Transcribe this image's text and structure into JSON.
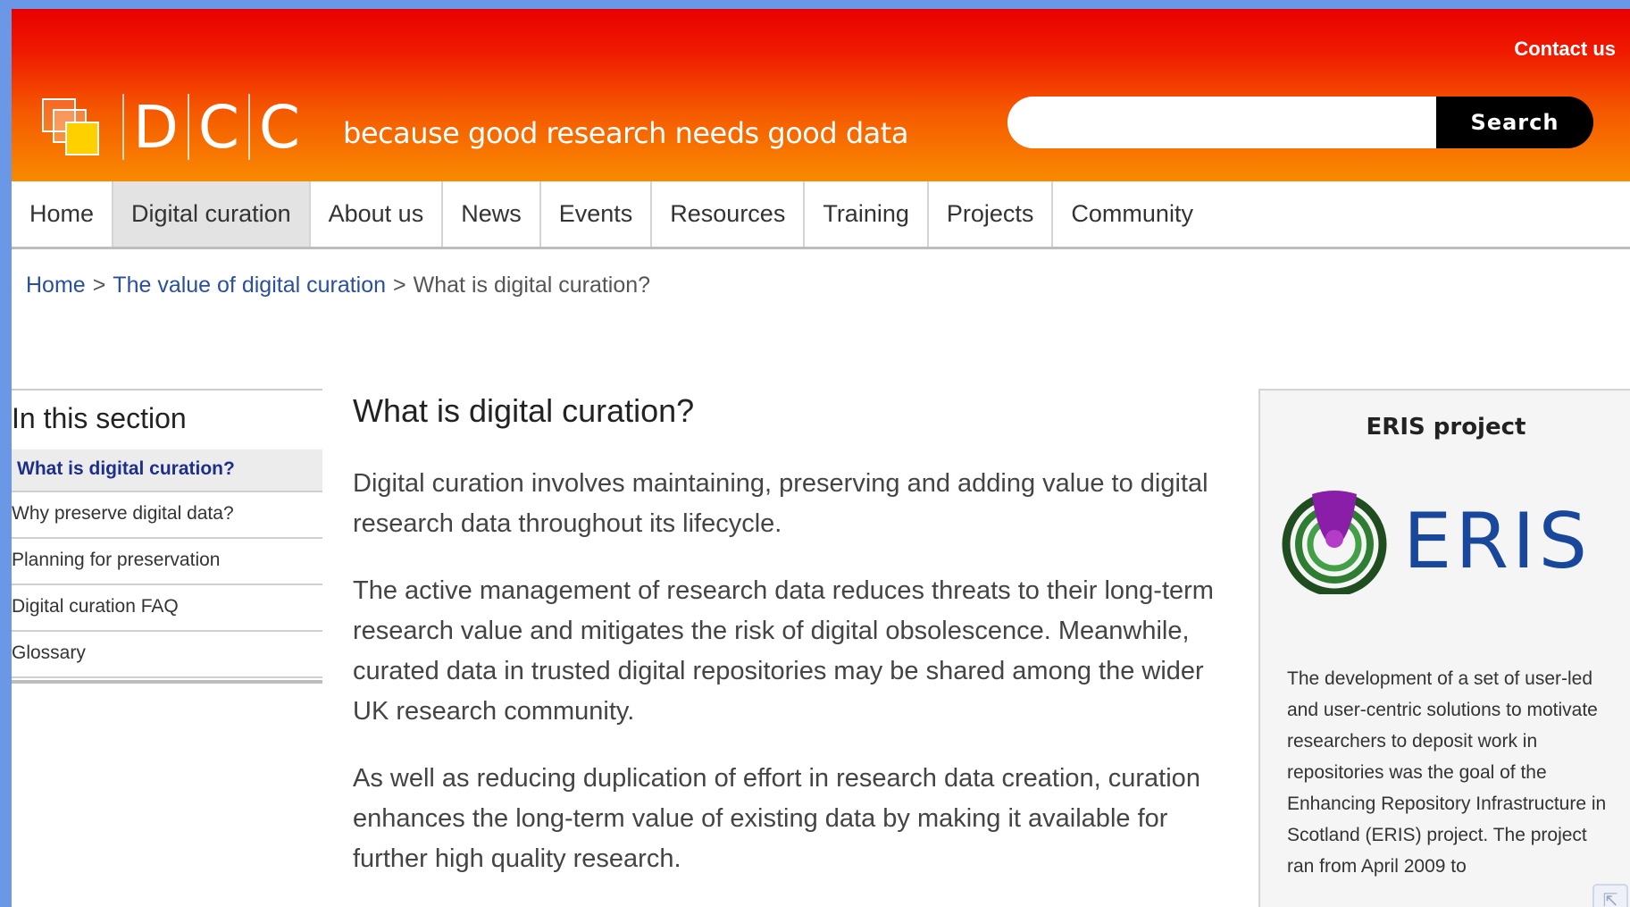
{
  "header": {
    "contact_label": "Contact us",
    "logo_letters": [
      "D",
      "C",
      "C"
    ],
    "tagline": "because good research needs good data",
    "search_placeholder": "",
    "search_button": "Search"
  },
  "nav": {
    "items": [
      {
        "label": "Home"
      },
      {
        "label": "Digital curation",
        "active": true
      },
      {
        "label": "About us"
      },
      {
        "label": "News"
      },
      {
        "label": "Events"
      },
      {
        "label": "Resources"
      },
      {
        "label": "Training"
      },
      {
        "label": "Projects"
      },
      {
        "label": "Community"
      }
    ]
  },
  "breadcrumb": {
    "home": "Home",
    "separator": ">",
    "parent": "The value of digital curation",
    "current": "What is digital curation?"
  },
  "sidebar": {
    "title": "In this section",
    "items": [
      {
        "label": "What is digital curation?",
        "active": true
      },
      {
        "label": "Why preserve digital data?"
      },
      {
        "label": "Planning for preservation"
      },
      {
        "label": "Digital curation FAQ"
      },
      {
        "label": "Glossary"
      }
    ]
  },
  "main": {
    "title": "What is digital curation?",
    "paragraphs": [
      "Digital curation involves maintaining, preserving and adding value to digital research data throughout its lifecycle.",
      "The active management of research data reduces threats to their long-term research value and mitigates the risk of digital obsolescence. Meanwhile, curated data in trusted digital repositories may be shared among the wider UK research community.",
      "As well as reducing duplication of effort in research data creation, curation enhances the long-term value of existing data by making it available for further high quality research."
    ]
  },
  "aside": {
    "title": "ERIS project",
    "logo_text": "ERIS",
    "body": "The development of a set of user-led and user-centric solutions to motivate researchers to deposit work in repositories was the goal of the Enhancing Repository Infrastructure in Scotland (ERIS) project. The project ran from April 2009 to"
  },
  "icons": {
    "logo": "dcc-logo-icon",
    "eris": "eris-logo-icon",
    "corner": "share-icon"
  },
  "colors": {
    "header_top": "#e80000",
    "header_bottom": "#f98a00",
    "link": "#2a4ea0",
    "sidebar_active": "#1d2f8a",
    "eris_blue": "#18479c"
  }
}
